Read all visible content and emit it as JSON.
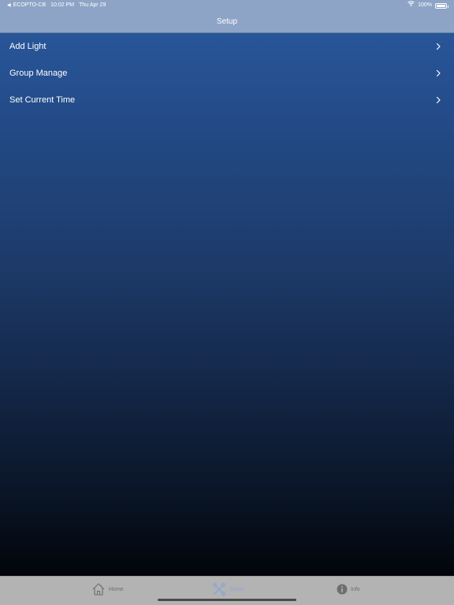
{
  "status_bar": {
    "back_app": "ECOPTO-CB",
    "time": "10:02 PM",
    "date": "Thu Apr 29",
    "battery": "100%",
    "battery_level": 1.0,
    "icons": [
      "back-arrow-icon",
      "wifi-icon",
      "battery-icon"
    ]
  },
  "nav": {
    "title": "Setup"
  },
  "menu": {
    "items": [
      {
        "label": "Add Light",
        "icon": "chevron-right-icon"
      },
      {
        "label": "Group Manage",
        "icon": "chevron-right-icon"
      },
      {
        "label": "Set Current Time",
        "icon": "chevron-right-icon"
      }
    ]
  },
  "tab_bar": {
    "tabs": [
      {
        "label": "Home",
        "icon": "house-icon",
        "active": false
      },
      {
        "label": "Setup",
        "icon": "tools-icon",
        "active": true
      },
      {
        "label": "Info",
        "icon": "info-icon",
        "active": false
      }
    ],
    "active_color": "#8ea6d2",
    "inactive_color": "#6e6e6e"
  },
  "colors": {
    "bar_background": "#8ea4c6",
    "gradient_top": "#2a5aa0",
    "gradient_bottom": "#02050a",
    "tab_bar_background": "#b3b3b3"
  }
}
